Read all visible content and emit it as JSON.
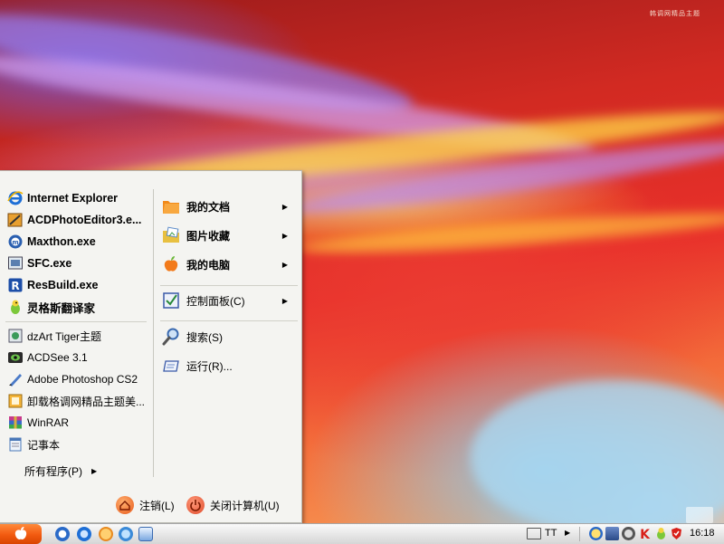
{
  "desktop": {
    "watermark": "韩调网精品主题"
  },
  "start_menu": {
    "pinned": [
      {
        "label": "Internet Explorer",
        "icon": "internet-explorer-icon"
      },
      {
        "label": "ACDPhotoEditor3.e...",
        "icon": "acd-photo-editor-icon"
      },
      {
        "label": "Maxthon.exe",
        "icon": "maxthon-icon"
      },
      {
        "label": "SFC.exe",
        "icon": "sfc-icon"
      },
      {
        "label": "ResBuild.exe",
        "icon": "resbuild-icon"
      },
      {
        "label": "灵格斯翻译家",
        "icon": "lingoes-icon"
      }
    ],
    "recent": [
      {
        "label": "dzArt Tiger主题",
        "icon": "dzart-icon"
      },
      {
        "label": "ACDSee 3.1",
        "icon": "acdsee-icon"
      },
      {
        "label": "Adobe Photoshop CS2",
        "icon": "photoshop-icon"
      },
      {
        "label": "卸载格调网精品主题美...",
        "icon": "uninstall-icon"
      },
      {
        "label": "WinRAR",
        "icon": "winrar-icon"
      },
      {
        "label": "记事本",
        "icon": "notepad-icon"
      }
    ],
    "all_programs": "所有程序(P)",
    "right": {
      "my_documents": "我的文档",
      "pictures": "图片收藏",
      "my_computer": "我的电脑",
      "control_panel": "控制面板(C)",
      "search": "搜索(S)",
      "run": "运行(R)..."
    },
    "footer": {
      "logoff": "注销(L)",
      "shutdown": "关闭计算机(U)"
    }
  },
  "taskbar": {
    "tray_ime": "TT",
    "clock": "16:18"
  },
  "colors": {
    "start_button": "#f25a10",
    "menu_bg": "#f4f4f1"
  }
}
